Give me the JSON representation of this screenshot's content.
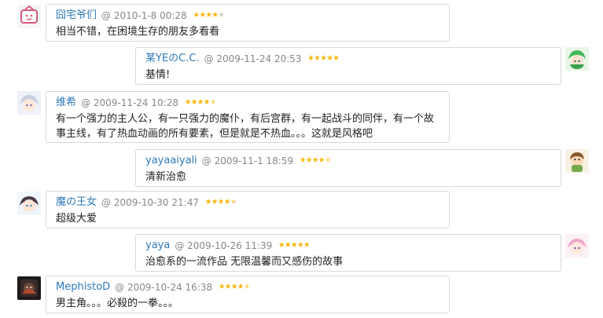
{
  "comments": [
    {
      "name": "囧宅爷们",
      "datetime": "@ 2010-1-8 00:28",
      "rating": 4,
      "text": "相当不错，在困境生存的朋友多看看",
      "avatar": "tv-face-icon",
      "color": "#f7b500"
    },
    {
      "name": "某YEのC.C.",
      "datetime": "@ 2009-11-24 20:53",
      "rating": 5,
      "text": "基情!",
      "avatar": "green-hair-anime-icon",
      "color": "#f7b500"
    },
    {
      "name": "维希",
      "datetime": "@ 2009-11-24 10:28",
      "rating": 4.5,
      "text": "有一个强力的主人公，有一只强力的魔仆，有后宫群，有一起战斗的同伴，有一个故\n事主线，有了热血动画的所有要素，但是就是不热血。。。这就是风格吧",
      "avatar": "silver-hair-anime-icon",
      "color": "#f7b500"
    },
    {
      "name": "yayaaiyali",
      "datetime": "@ 2009-11-1 18:59",
      "rating": 4.5,
      "text": "清新治愈",
      "avatar": "cartoon-kid-icon",
      "color": "#f7b500"
    },
    {
      "name": "魔の王女",
      "datetime": "@ 2009-10-30 21:47",
      "rating": 4.5,
      "text": "超级大爱",
      "avatar": "dark-hair-anime-icon",
      "color": "#f7b500"
    },
    {
      "name": "yaya",
      "datetime": "@ 2009-10-26 11:39",
      "rating": 5,
      "text": "治愈系的一流作品 无限温馨而又感伤的故事",
      "avatar": "pink-hair-anime-icon",
      "color": "#f7b500"
    },
    {
      "name": "MephistoD",
      "datetime": "@ 2009-10-24 16:38",
      "rating": 4.5,
      "text": "男主角。。。必殺的一拳。。。",
      "avatar": "dark-character-icon",
      "color": "#f7b500"
    }
  ]
}
